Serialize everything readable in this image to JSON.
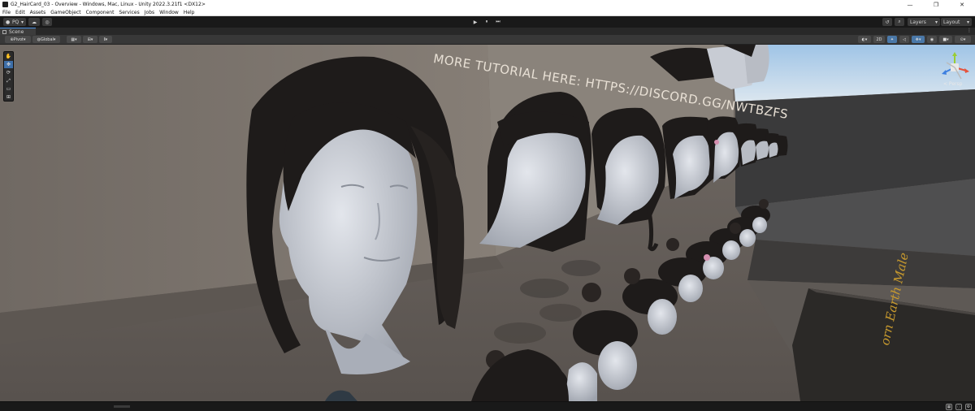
{
  "window": {
    "title": "G2_HairCard_03 - Overview - Windows, Mac, Linux - Unity 2022.3.21f1 <DX12>",
    "minimize": "—",
    "maximize": "❐",
    "close": "✕"
  },
  "menu": {
    "items": [
      "File",
      "Edit",
      "Assets",
      "GameObject",
      "Component",
      "Services",
      "Jobs",
      "Window",
      "Help"
    ]
  },
  "toolbar": {
    "account_label": "PQ",
    "play": "▶",
    "pause": "⏸",
    "step": "⏭",
    "layers_label": "Layers",
    "layout_label": "Layout"
  },
  "scene_tab": {
    "label": "Scene",
    "menu": "⋮"
  },
  "scene_toolbar": {
    "pivot_label": "Pivot",
    "global_label": "Global",
    "mode_2d": "2D"
  },
  "viewport": {
    "sign_text": "MORE TUTORIAL HERE: HTTPS://DISCORD.GG/NWTBZFS",
    "book_text": "orn Earth Male",
    "projection_label": "< Persp"
  },
  "tools": [
    "✋",
    "✥",
    "⟳",
    "⤢",
    "▭",
    "⊞"
  ],
  "colors": {
    "editor_bg": "#191919",
    "toolbar_bg": "#383838",
    "accent": "#4a78a8",
    "wall": "#7d756d",
    "floor": "#6b6560",
    "sky": "#c6dcef",
    "skin": "#c8ccd4",
    "hair": "#1e1b1a"
  }
}
